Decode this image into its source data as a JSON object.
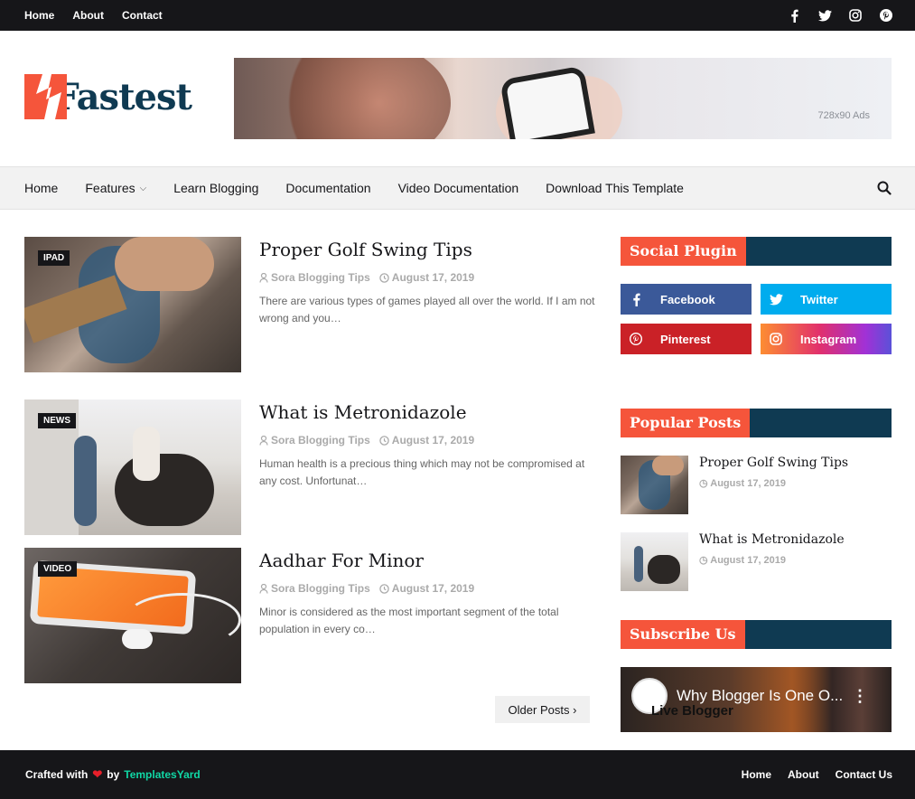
{
  "topbar": {
    "links": [
      "Home",
      "About",
      "Contact"
    ],
    "social_icons": [
      "facebook-icon",
      "twitter-icon",
      "instagram-icon",
      "pinterest-icon"
    ]
  },
  "header": {
    "logo_text": "Fastest",
    "ad_text": "728x90 Ads"
  },
  "nav": {
    "items": [
      {
        "label": "Home"
      },
      {
        "label": "Features",
        "caret": "⌵"
      },
      {
        "label": "Learn Blogging"
      },
      {
        "label": "Documentation"
      },
      {
        "label": "Video Documentation"
      },
      {
        "label": "Download This Template"
      }
    ]
  },
  "posts": [
    {
      "label": "IPAD",
      "title": "Proper Golf Swing Tips",
      "author": "Sora Blogging Tips",
      "date": "August 17, 2019",
      "snippet": "There are various types of games played all over the world. If I am not wrong and you…"
    },
    {
      "label": "NEWS",
      "title": "What is Metronidazole",
      "author": "Sora Blogging Tips",
      "date": "August 17, 2019",
      "snippet": "Human health is a precious thing which may not be compromised at any cost. Unfortunat…"
    },
    {
      "label": "VIDEO",
      "title": "Aadhar For Minor",
      "author": "Sora Blogging Tips",
      "date": "August 17, 2019",
      "snippet": "Minor is considered as the most important segment of the total population in every co…"
    }
  ],
  "pagination": {
    "older_label": "Older Posts",
    "chevron": "›"
  },
  "sidebar": {
    "social_title": "Social Plugin",
    "social_buttons": [
      {
        "label": "Facebook",
        "color": "#3b5999"
      },
      {
        "label": "Twitter",
        "color": "#00acee"
      },
      {
        "label": "Pinterest",
        "color": "#ca2127"
      },
      {
        "label": "Instagram",
        "color": "#dd277b"
      }
    ],
    "popular_title": "Popular Posts",
    "popular": [
      {
        "title": "Proper Golf Swing Tips",
        "date": "August 17, 2019"
      },
      {
        "title": "What is Metronidazole",
        "date": "August 17, 2019"
      }
    ],
    "subscribe_title": "Subscribe Us",
    "video": {
      "title": "Why Blogger Is One O...",
      "channel": "Live Blogger",
      "menu": "⋮"
    }
  },
  "footer": {
    "crafted": "Crafted with",
    "heart": "❤",
    "by": "by",
    "brand": "TemplatesYard",
    "links": [
      "Home",
      "About",
      "Contact Us"
    ]
  },
  "colors": {
    "accent": "#f5553b",
    "dark_blue": "#0f3a52",
    "dark": "#161619",
    "brand_green": "#10d7a5"
  }
}
